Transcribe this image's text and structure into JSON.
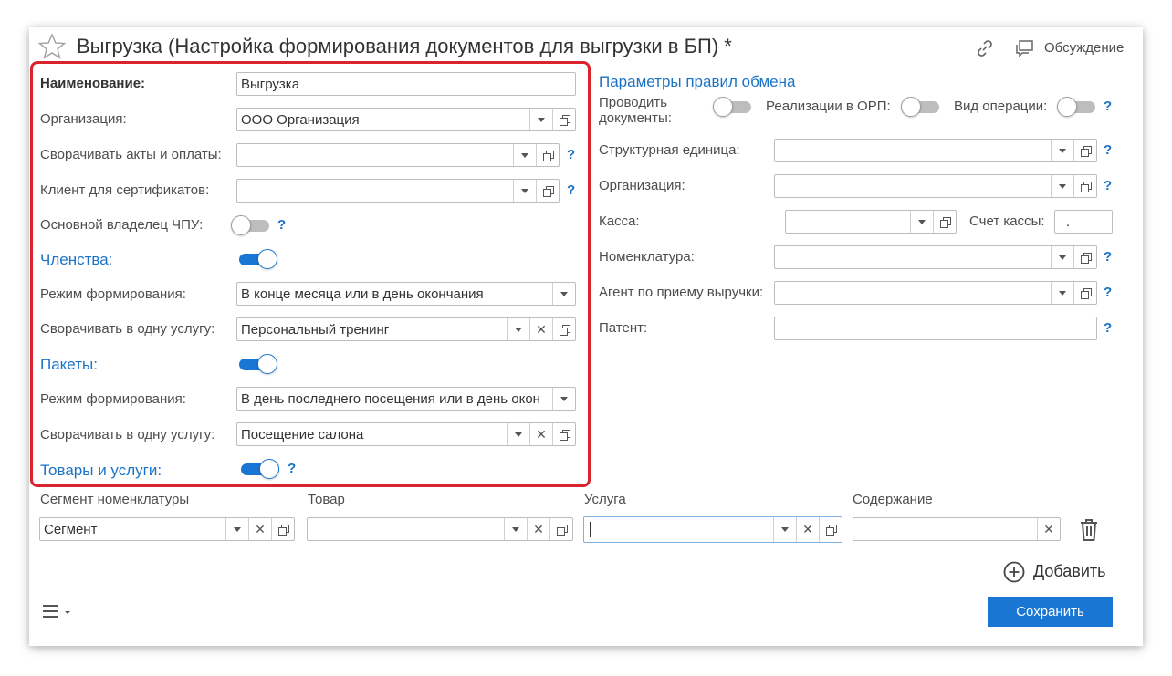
{
  "header": {
    "title": "Выгрузка (Настройка формирования документов для выгрузки в БП) *",
    "discussion_label": "Обсуждение"
  },
  "left": {
    "name_label": "Наименование:",
    "name_value": "Выгрузка",
    "org_label": "Организация:",
    "org_value": "ООО Организация",
    "collapse_acts_label": "Сворачивать акты и оплаты:",
    "collapse_acts_value": "",
    "cert_client_label": "Клиент для сертификатов:",
    "cert_client_value": "",
    "cnc_owner_label": "Основной владелец ЧПУ:",
    "membership_label": "Членства:",
    "membership_mode_label": "Режим формирования:",
    "membership_mode_value": "В конце месяца или в день окончания",
    "membership_collapse_label": "Сворачивать в одну услугу:",
    "membership_collapse_value": "Персональный тренинг",
    "packages_label": "Пакеты:",
    "packages_mode_label": "Режим формирования:",
    "packages_mode_value": "В день последнего посещения или в день окон",
    "packages_collapse_label": "Сворачивать в одну услугу:",
    "packages_collapse_value": "Посещение салона",
    "goods_label": "Товары и услуги:"
  },
  "right": {
    "section_title": "Параметры правил обмена",
    "post_docs_label": "Проводить документы:",
    "orp_label": "Реализации в ОРП:",
    "op_type_label": "Вид операции:",
    "struct_unit_label": "Структурная единица:",
    "org_label": "Организация:",
    "cash_label": "Касса:",
    "cash_account_label": "Счет кассы:",
    "cash_account_value": ".",
    "nomenclature_label": "Номенклатура:",
    "agent_label": "Агент по приему выручки:",
    "patent_label": "Патент:"
  },
  "table": {
    "col_segment": "Сегмент номенклатуры",
    "col_goods": "Товар",
    "col_service": "Услуга",
    "col_content": "Содержание",
    "segment_value": "Сегмент",
    "goods_value": "",
    "service_value": "",
    "content_value": "",
    "add_label": "Добавить"
  },
  "footer": {
    "save_label": "Сохранить"
  },
  "help_mark": "?",
  "icons": {
    "star": "star-icon",
    "link": "link-icon",
    "discussion": "chat-icon",
    "trash": "trash-icon",
    "add": "plus-circle-icon",
    "menu": "hamburger-icon"
  },
  "colors": {
    "accent": "#1976d2",
    "highlight_border": "#d9232d"
  }
}
